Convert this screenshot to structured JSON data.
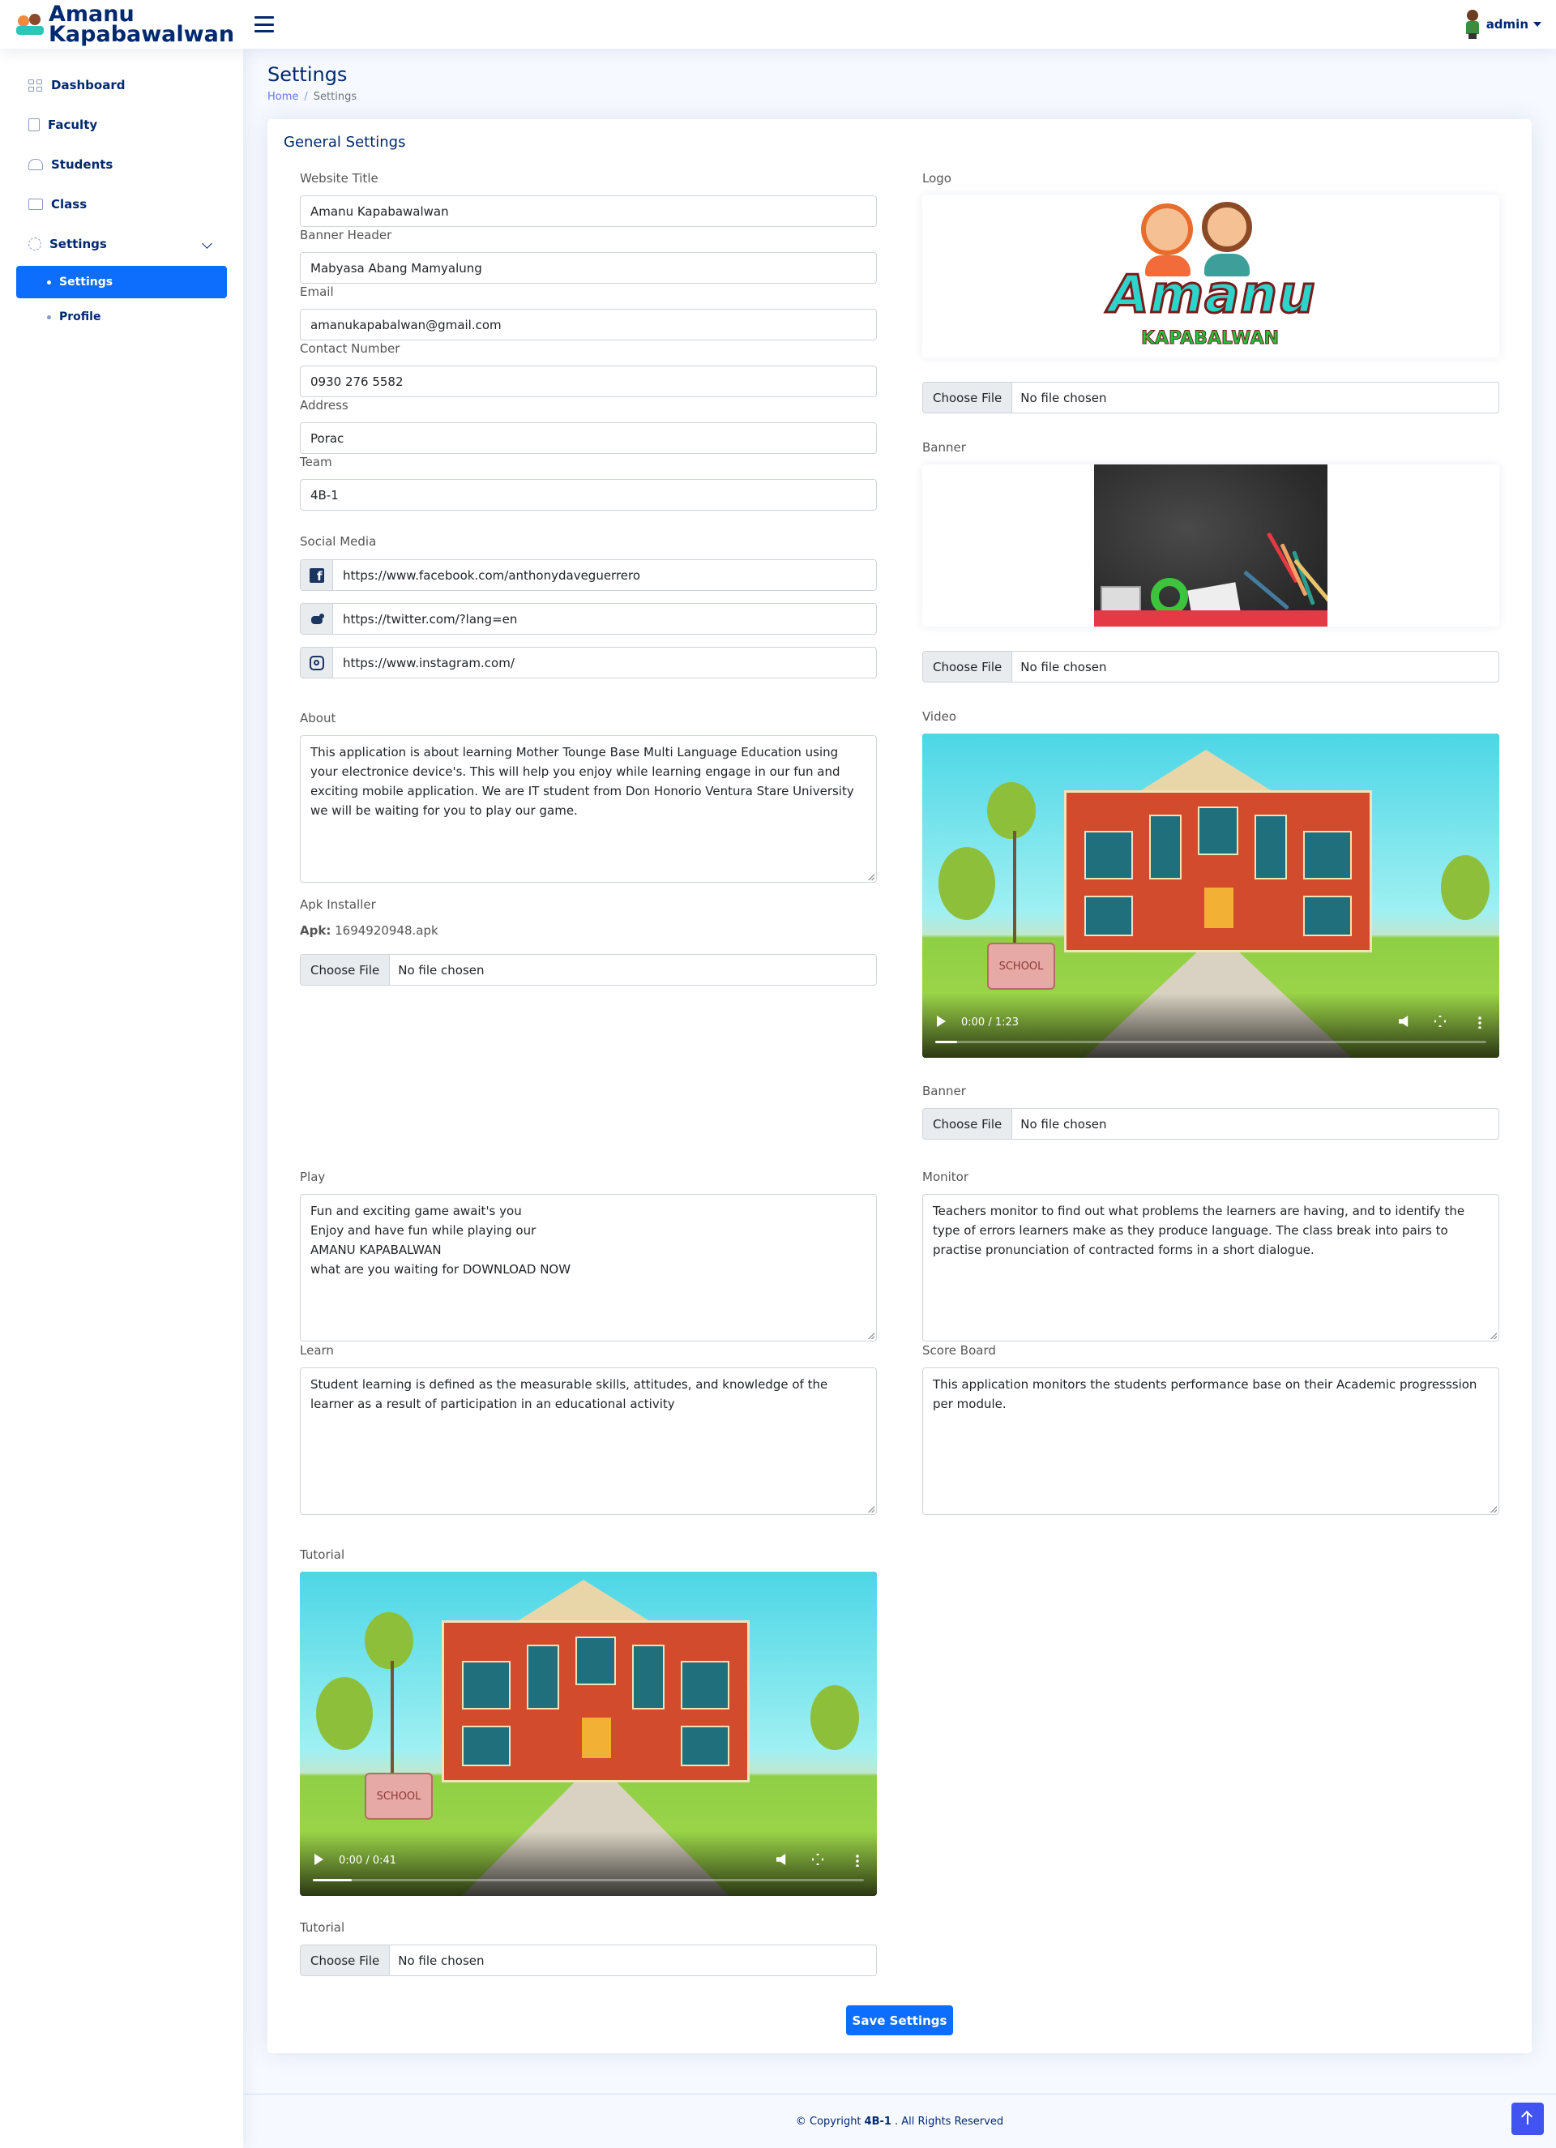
{
  "app": {
    "title_line1": "Amanu",
    "title_line2": "Kapabawalwan",
    "user": "admin"
  },
  "sidebar": {
    "items": [
      {
        "label": "Dashboard",
        "icon": "grid-icon"
      },
      {
        "label": "Faculty",
        "icon": "id-card-icon"
      },
      {
        "label": "Students",
        "icon": "people-icon"
      },
      {
        "label": "Class",
        "icon": "card-list-icon"
      },
      {
        "label": "Settings",
        "icon": "gear-icon"
      }
    ],
    "sub_items": [
      {
        "label": "Settings",
        "active": true
      },
      {
        "label": "Profile",
        "active": false
      }
    ]
  },
  "page": {
    "title": "Settings",
    "breadcrumb": [
      "Home",
      "/",
      "Settings"
    ]
  },
  "form": {
    "card_title": "General Settings",
    "website_title": {
      "label": "Website Title",
      "value": "Amanu Kapabawalwan"
    },
    "banner_header": {
      "label": "Banner Header",
      "value": "Mabyasa Abang Mamyalung"
    },
    "email": {
      "label": "Email",
      "value": "amanukapabalwan@gmail.com"
    },
    "contact": {
      "label": "Contact Number",
      "value": "0930 276 5582"
    },
    "address": {
      "label": "Address",
      "value": "Porac"
    },
    "team": {
      "label": "Team",
      "value": "4B-1"
    },
    "social": {
      "label": "Social Media",
      "facebook": "https://www.facebook.com/anthonydaveguerrero",
      "twitter": "https://twitter.com/?lang=en",
      "instagram": "https://www.instagram.com/"
    },
    "about": {
      "label": "About",
      "value": "This application is about learning Mother Tounge Base Multi Language Education using your electronice device's. This will help you enjoy while learning engage in our fun and exciting mobile application. We are IT student from Don Honorio Ventura Stare University we will be waiting for you to play our game."
    },
    "apk": {
      "label": "Apk Installer",
      "prefix": "Apk:",
      "filename": "1694920948.apk"
    },
    "play": {
      "label": "Play",
      "value": "Fun and exciting game await's you\nEnjoy and have fun while playing our\nAMANU KAPABALWAN\nwhat are you waiting for DOWNLOAD NOW"
    },
    "monitor": {
      "label": "Monitor",
      "value": "Teachers monitor to find out what problems the learners are having, and to identify the type of errors learners make as they produce language. The class break into pairs to practise pronunciation of contracted forms in a short dialogue."
    },
    "learn": {
      "label": "Learn",
      "value": "Student learning is defined as the measurable skills, attitudes, and knowledge of the learner as a result of participation in an educational activity"
    },
    "scoreboard": {
      "label": "Score Board",
      "value": "This application monitors the students performance base on their Academic progresssion per module."
    },
    "logo": {
      "label": "Logo",
      "art_word": "Amanu",
      "art_sub": "KAPABALWAN"
    },
    "banner": {
      "label": "Banner"
    },
    "video": {
      "label": "Video",
      "time": "0:00 / 1:23",
      "progress": 0.0
    },
    "banner2": {
      "label": "Banner"
    },
    "tutorial": {
      "label": "Tutorial",
      "time": "0:00 / 0:41",
      "progress": 0.0
    },
    "tutorial_file": {
      "label": "Tutorial"
    },
    "file": {
      "button": "Choose File",
      "none": "No file chosen"
    },
    "sign_text": "SCHOOL",
    "save": "Save Settings"
  },
  "footer": {
    "prefix": "© Copyright",
    "team": "4B-1",
    "suffix": ". All Rights Reserved"
  }
}
